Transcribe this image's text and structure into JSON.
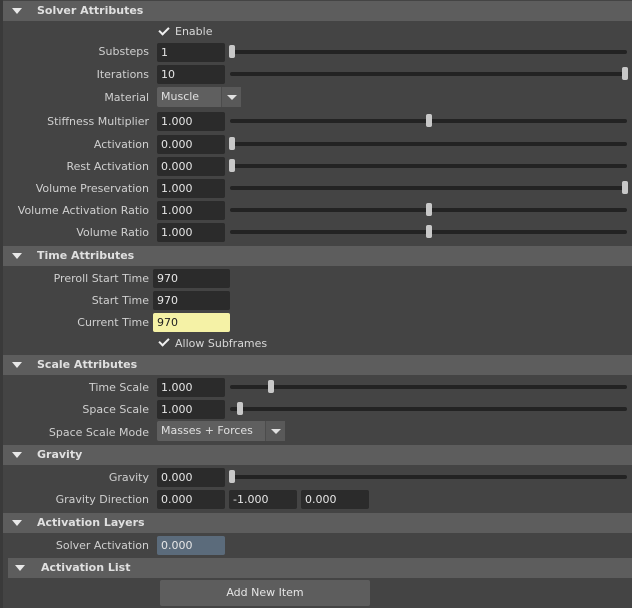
{
  "solver": {
    "title": "Solver Attributes",
    "enable_label": "Enable",
    "enable_checked": true,
    "substeps": {
      "label": "Substeps",
      "value": "1",
      "slider": 0.0
    },
    "iterations": {
      "label": "Iterations",
      "value": "10",
      "slider": 1.0
    },
    "material": {
      "label": "Material",
      "value": "Muscle"
    },
    "stiffness": {
      "label": "Stiffness Multiplier",
      "value": "1.000",
      "slider": 0.5
    },
    "activation": {
      "label": "Activation",
      "value": "0.000",
      "slider": 0.0
    },
    "rest_activation": {
      "label": "Rest Activation",
      "value": "0.000",
      "slider": 0.0
    },
    "volume_preservation": {
      "label": "Volume Preservation",
      "value": "1.000",
      "slider": 1.0
    },
    "volume_activation_ratio": {
      "label": "Volume Activation Ratio",
      "value": "1.000",
      "slider": 0.5
    },
    "volume_ratio": {
      "label": "Volume Ratio",
      "value": "1.000",
      "slider": 0.5
    }
  },
  "time": {
    "title": "Time Attributes",
    "preroll": {
      "label": "Preroll Start Time",
      "value": "970"
    },
    "start": {
      "label": "Start Time",
      "value": "970"
    },
    "current": {
      "label": "Current Time",
      "value": "970"
    },
    "allow_subframes_label": "Allow Subframes",
    "allow_subframes_checked": true
  },
  "scale": {
    "title": "Scale Attributes",
    "time_scale": {
      "label": "Time Scale",
      "value": "1.000",
      "slider": 0.1
    },
    "space_scale": {
      "label": "Space Scale",
      "value": "1.000",
      "slider": 0.02
    },
    "space_scale_mode": {
      "label": "Space Scale Mode",
      "value": "Masses + Forces"
    }
  },
  "gravity": {
    "title": "Gravity",
    "gravity": {
      "label": "Gravity",
      "value": "0.000",
      "slider": 0.0
    },
    "direction": {
      "label": "Gravity Direction",
      "x": "0.000",
      "y": "-1.000",
      "z": "0.000"
    }
  },
  "activation_layers": {
    "title": "Activation Layers",
    "solver_activation": {
      "label": "Solver Activation",
      "value": "0.000"
    },
    "list_title": "Activation List",
    "add_button": "Add New Item"
  },
  "colors": {
    "background": "#444444",
    "header": "#5d5d5d",
    "field": "#2b2b2b",
    "highlight_field": "#f5f2a6",
    "keyed_field": "#5b6b7b"
  }
}
